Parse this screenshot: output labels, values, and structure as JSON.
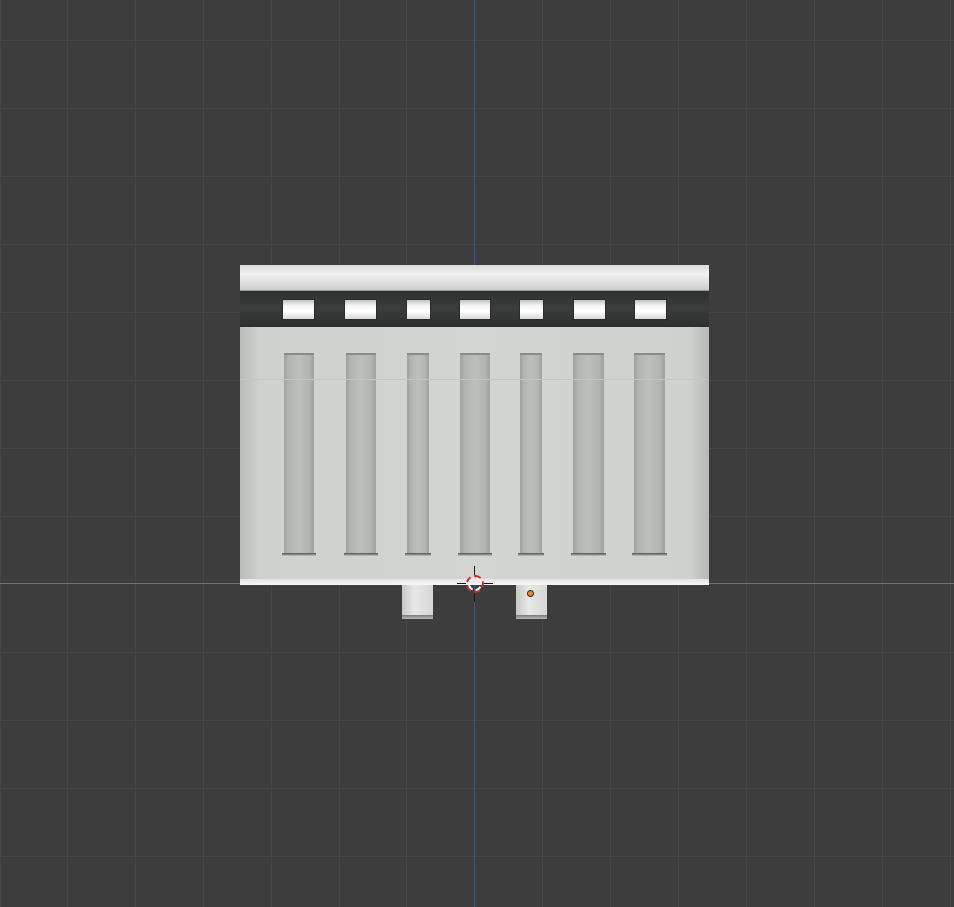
{
  "viewport": {
    "background": "#3d3d3d",
    "grid_color": "#474747",
    "axis_x_color": "#5d8a32",
    "axis_y_color": "#2f5b9a"
  },
  "model": {
    "windows_count": 7,
    "slots_count": 7,
    "legs_count": 2
  },
  "cursor": {
    "icon": "3d-cursor-icon",
    "color_primary": "#d02a2a",
    "color_secondary": "#f2f2f2"
  },
  "origin": {
    "icon": "object-origin-icon",
    "color": "#f08a1c"
  }
}
